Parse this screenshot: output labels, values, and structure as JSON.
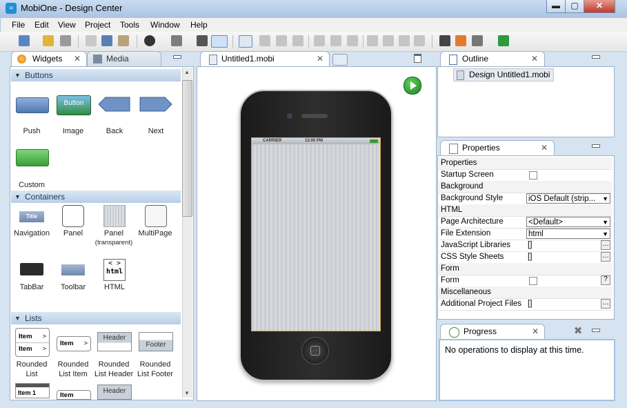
{
  "window": {
    "title": "MobiOne - Design Center",
    "min": "▬",
    "max": "▢",
    "close": "✕"
  },
  "menu": [
    "File",
    "Edit",
    "View",
    "Project",
    "Tools",
    "Window",
    "Help"
  ],
  "left_panel": {
    "tabs": [
      {
        "label": "Widgets",
        "icon": "palette-icon"
      },
      {
        "label": "Media",
        "icon": "image-icon"
      }
    ],
    "sections": [
      {
        "title": "Buttons",
        "items": [
          "Push",
          "Image",
          "Back",
          "Next",
          "Custom"
        ],
        "image_button_text": "Button"
      },
      {
        "title": "Containers",
        "items": [
          "Navigation",
          "Panel",
          "Panel",
          "MultiPage",
          "TabBar",
          "Toolbar",
          "HTML"
        ],
        "panel_sub": "(transparent)",
        "nav_icon_text": "Title",
        "html_icon_text": "html"
      },
      {
        "title": "Lists",
        "items": [
          [
            "Rounded",
            "List"
          ],
          [
            "Rounded",
            "List Item"
          ],
          [
            "Rounded",
            "List Header"
          ],
          [
            "Rounded",
            "List Footer"
          ]
        ],
        "icon_texts": [
          "Item",
          "Item",
          "Item",
          "Header",
          "Footer",
          "Item 1",
          "Item",
          "Header"
        ]
      }
    ]
  },
  "editor": {
    "tab": {
      "label": "Untitled1.mobi"
    },
    "status_carrier": "CARRIER",
    "status_time": "12:00 PM"
  },
  "outline": {
    "tab": "Outline",
    "item": "Design Untitled1.mobi"
  },
  "properties": {
    "tab": "Properties",
    "rows": [
      {
        "type": "cat",
        "name": "Properties"
      },
      {
        "type": "check",
        "name": "Startup Screen"
      },
      {
        "type": "cat",
        "name": "Background"
      },
      {
        "type": "drop",
        "name": "Background Style",
        "value": "iOS Default (strip..."
      },
      {
        "type": "cat",
        "name": "HTML"
      },
      {
        "type": "drop",
        "name": "Page Architecture",
        "value": "<Default>"
      },
      {
        "type": "drop",
        "name": "File Extension",
        "value": "html"
      },
      {
        "type": "list",
        "name": "JavaScript Libraries",
        "value": "[]"
      },
      {
        "type": "list",
        "name": "CSS Style Sheets",
        "value": "[]"
      },
      {
        "type": "cat",
        "name": "Form"
      },
      {
        "type": "help",
        "name": "Form"
      },
      {
        "type": "cat",
        "name": "Miscellaneous"
      },
      {
        "type": "list",
        "name": "Additional Project Files",
        "value": "[]"
      }
    ]
  },
  "progress": {
    "tab": "Progress",
    "message": "No operations to display at this time."
  }
}
